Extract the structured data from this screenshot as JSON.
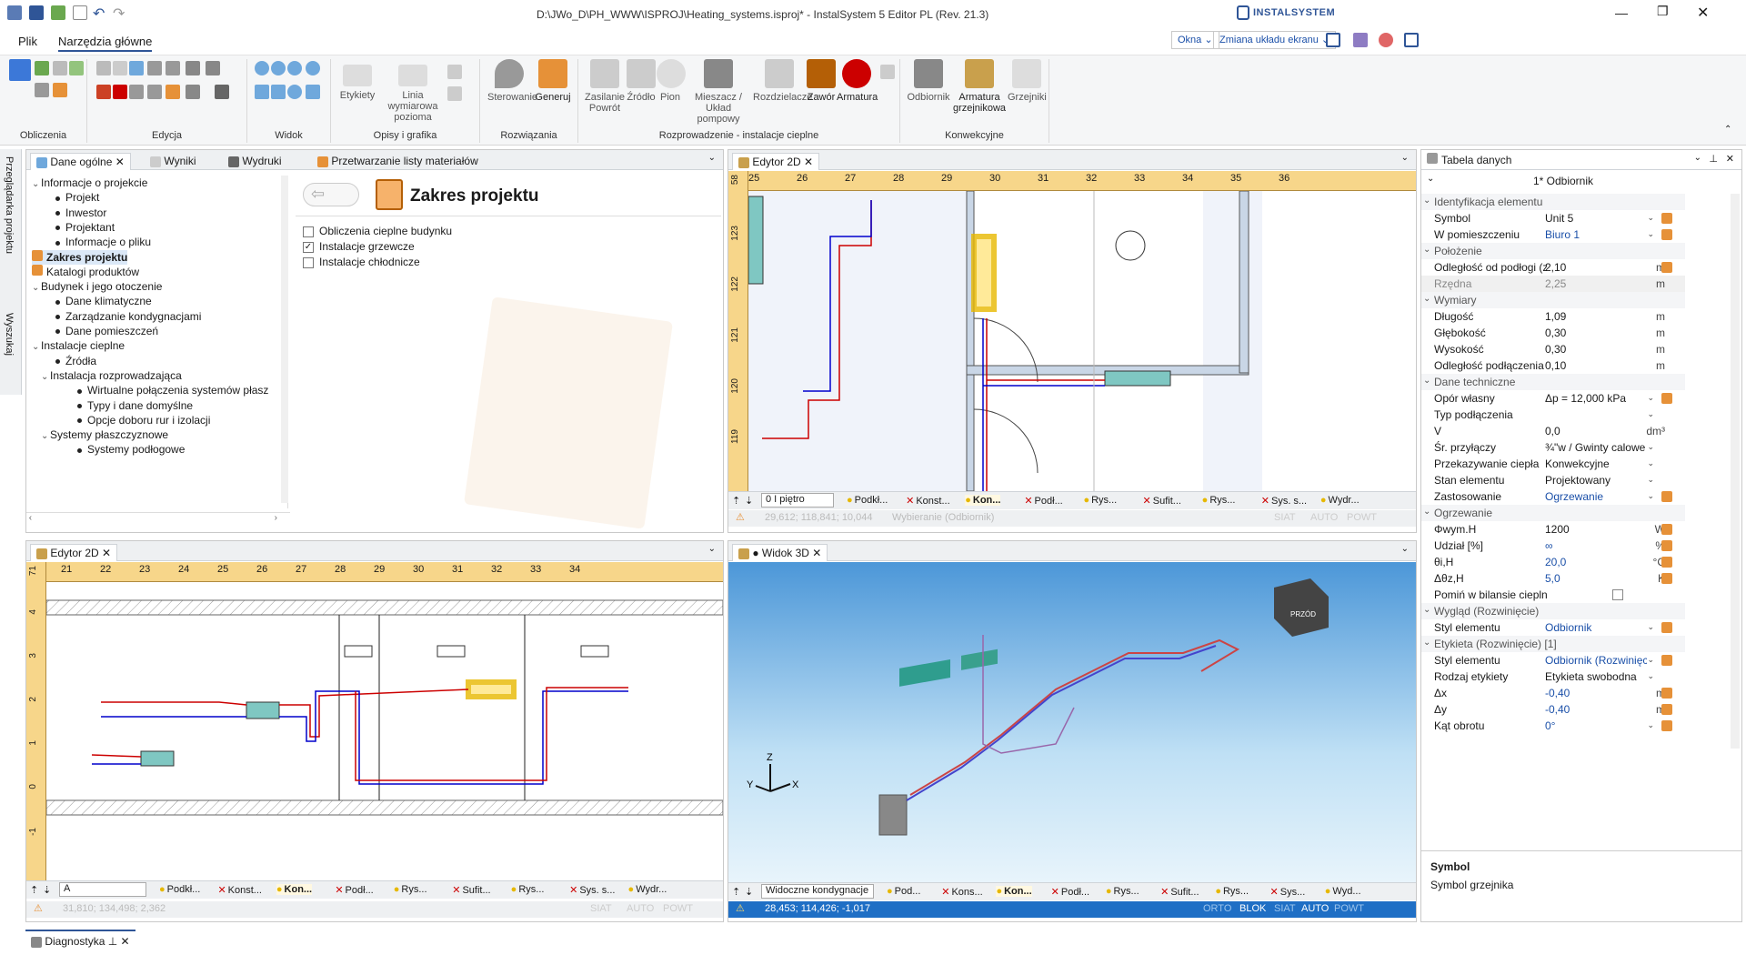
{
  "title": "D:\\JWo_D\\PH_WWW\\ISPROJ\\Heating_systems.isproj* - InstalSystem 5 Editor PL (Rev. 21.3)",
  "brand": "INSTALSYSTEM",
  "menu": {
    "file": "Plik",
    "main_tools": "Narzędzia główne"
  },
  "right_buttons": {
    "window": "Okna",
    "layout": "Zmiana układu ekranu"
  },
  "ribbon": {
    "groups": {
      "calc": "Obliczenia",
      "edit": "Edycja",
      "view": "Widok",
      "desc": "Opisy i grafika",
      "solutions": "Rozwiązania",
      "distribution": "Rozprowadzenie - instalacje cieplne",
      "convective": "Konwekcyjne"
    },
    "buttons": {
      "labels": "Etykiety",
      "dim_line": "Linia wymiarowa\npozioma",
      "control": "Sterowanie",
      "generate": "Generuj",
      "supply_return": "Zasilanie\nPowrót",
      "source": "Źródło",
      "riser": "Pion",
      "mixer": "Mieszacz / Układ\npompowy",
      "distributors": "Rozdzielacze",
      "valve": "Zawór",
      "fittings": "Armatura",
      "radiator": "Odbiornik",
      "radiator_fittings": "Armatura\ngrzejnikowa",
      "heaters": "Grzejniki"
    }
  },
  "left_panel": {
    "tabs": [
      "Dane ogólne",
      "Wyniki",
      "Wydruki",
      "Przetwarzanie listy materiałów"
    ],
    "tree": [
      {
        "label": "Informacje o projekcie",
        "lvl": 0,
        "chev": "v"
      },
      {
        "label": "Projekt",
        "lvl": 2
      },
      {
        "label": "Inwestor",
        "lvl": 2
      },
      {
        "label": "Projektant",
        "lvl": 2
      },
      {
        "label": "Informacje o pliku",
        "lvl": 2
      },
      {
        "label": "Zakres projektu",
        "lvl": 0,
        "sel": true
      },
      {
        "label": "Katalogi produktów",
        "lvl": 0
      },
      {
        "label": "Budynek i jego otoczenie",
        "lvl": 0,
        "chev": "v"
      },
      {
        "label": "Dane klimatyczne",
        "lvl": 2
      },
      {
        "label": "Zarządzanie kondygnacjami",
        "lvl": 2
      },
      {
        "label": "Dane pomieszczeń",
        "lvl": 2
      },
      {
        "label": "Instalacje cieplne",
        "lvl": 0,
        "chev": "v"
      },
      {
        "label": "Źródła",
        "lvl": 2
      },
      {
        "label": "Instalacja rozprowadzająca",
        "lvl": 1,
        "chev": "v"
      },
      {
        "label": "Wirtualne połączenia systemów płasz",
        "lvl": 3
      },
      {
        "label": "Typy i dane domyślne",
        "lvl": 3
      },
      {
        "label": "Opcje doboru rur i izolacji",
        "lvl": 3
      },
      {
        "label": "Systemy płaszczyznowe",
        "lvl": 1,
        "chev": "v"
      },
      {
        "label": "Systemy podłogowe",
        "lvl": 3
      }
    ],
    "scope_title": "Zakres projektu",
    "checks": [
      {
        "label": "Obliczenia cieplne budynku",
        "checked": false
      },
      {
        "label": "Instalacje grzewcze",
        "checked": true
      },
      {
        "label": "Instalacje chłodnicze",
        "checked": false
      }
    ]
  },
  "editor_top": {
    "tab": "Edytor 2D",
    "ruler": [
      "25",
      "26",
      "27",
      "28",
      "29",
      "30",
      "31",
      "32",
      "33",
      "34",
      "35",
      "36"
    ],
    "vruler": [
      "58",
      "123",
      "122",
      "121",
      "120",
      "119"
    ],
    "floor": "0 I piętro",
    "layers": [
      "Podkł...",
      "Konst...",
      "Kon...",
      "Podł...",
      "Rys...",
      "Sufit...",
      "Rys...",
      "Sys. s...",
      "Wydr..."
    ],
    "status": "29,612; 118,841; 10,044",
    "status2": "Wybieranie (Odbiornik)",
    "flags": [
      "SIAT",
      "AUTO",
      "POWT"
    ]
  },
  "editor_bottom": {
    "tab": "Edytor 2D",
    "ruler": [
      "21",
      "22",
      "23",
      "24",
      "25",
      "26",
      "27",
      "28",
      "29",
      "30",
      "31",
      "32",
      "33",
      "34"
    ],
    "vruler": [
      "71",
      "4",
      "3",
      "2",
      "1",
      "0",
      "-1"
    ],
    "view": "A",
    "layers": [
      "Podkł...",
      "Konst...",
      "Kon...",
      "Podł...",
      "Rys...",
      "Sufit...",
      "Rys...",
      "Sys. s...",
      "Wydr..."
    ],
    "status": "31,810; 134,498; 2,362",
    "flags": [
      "SIAT",
      "AUTO",
      "POWT"
    ]
  },
  "view3d": {
    "tab": "● Widok 3D",
    "dropdown": "Widoczne kondygnacje",
    "layers": [
      "Pod...",
      "Kons...",
      "Kon...",
      "Podł...",
      "Rys...",
      "Sufit...",
      "Rys...",
      "Sys...",
      "Wyd..."
    ],
    "coords": "28,453; 114,426; -1,017",
    "flags": [
      "ORTO",
      "BLOK",
      "SIAT",
      "AUTO",
      "POWT"
    ],
    "cube_front": "PRZÓD"
  },
  "datatable": {
    "title": "Tabela danych",
    "subtitle": "1* Odbiornik",
    "rows": [
      {
        "t": "sec",
        "name": "Identyfikacja elementu"
      },
      {
        "name": "Symbol",
        "val": "Unit 5",
        "dd": true,
        "edit": true
      },
      {
        "name": "W pomieszczeniu",
        "val": "Biuro 1",
        "dd": true,
        "blue": true,
        "edit": true
      },
      {
        "t": "sec",
        "name": "Położenie"
      },
      {
        "name": "Odległość od podłogi (z dan",
        "val": "2,10",
        "unit": "m",
        "edit": true
      },
      {
        "name": "Rzędna",
        "val": "2,25",
        "unit": "m",
        "grey": true
      },
      {
        "t": "sec",
        "name": "Wymiary"
      },
      {
        "name": "Długość",
        "val": "1,09",
        "unit": "m"
      },
      {
        "name": "Głębokość",
        "val": "0,30",
        "unit": "m"
      },
      {
        "name": "Wysokość",
        "val": "0,30",
        "unit": "m"
      },
      {
        "name": "Odległość podłączenia od k",
        "val": "0,10",
        "unit": "m"
      },
      {
        "t": "sec",
        "name": "Dane techniczne"
      },
      {
        "name": "Opór własny",
        "val": "Δp = 12,000 kPa",
        "dd": true,
        "edit": true
      },
      {
        "name": "Typ podłączenia",
        "val": "",
        "dd": true
      },
      {
        "name": "V",
        "val": "0,0",
        "unit": "dm³"
      },
      {
        "name": "Śr. przyłączy",
        "val": "¾\"w / Gwinty calowe (w)",
        "dd": true
      },
      {
        "name": "Przekazywanie ciepła",
        "val": "Konwekcyjne",
        "dd": true
      },
      {
        "name": "Stan elementu",
        "val": "Projektowany",
        "dd": true
      },
      {
        "name": "Zastosowanie",
        "val": "Ogrzewanie",
        "dd": true,
        "blue": true,
        "edit": true
      },
      {
        "t": "sec",
        "name": "Ogrzewanie"
      },
      {
        "name": "Φwym.H",
        "val": "1200",
        "unit": "W",
        "edit": true
      },
      {
        "name": "Udział [%]",
        "val": "∞",
        "unit": "%",
        "blue": true,
        "edit": true
      },
      {
        "name": "θi,H",
        "val": "20,0",
        "unit": "°C",
        "blue": true,
        "edit": true
      },
      {
        "name": "Δθz,H",
        "val": "5,0",
        "unit": "K",
        "blue": true,
        "edit": true
      },
      {
        "name": "Pomiń w bilansie cieplnym",
        "val": "",
        "check": true
      },
      {
        "t": "sec",
        "name": "Wygląd (Rozwinięcie)"
      },
      {
        "name": "Styl elementu",
        "val": "Odbiornik",
        "dd": true,
        "blue": true,
        "edit": true
      },
      {
        "t": "sec",
        "name": "Etykieta (Rozwinięcie) [1]"
      },
      {
        "name": "Styl elementu",
        "val": "Odbiornik (Rozwinięcie)",
        "dd": true,
        "blue": true,
        "edit": true
      },
      {
        "name": "Rodzaj etykiety",
        "val": "Etykieta swobodna",
        "dd": true
      },
      {
        "name": "Δx",
        "val": "-0,40",
        "unit": "m",
        "blue": true,
        "edit": true
      },
      {
        "name": "Δy",
        "val": "-0,40",
        "unit": "m",
        "blue": true,
        "edit": true
      },
      {
        "name": "Kąt obrotu",
        "val": "0°",
        "dd": true,
        "blue": true,
        "edit": true
      }
    ],
    "help_title": "Symbol",
    "help_text": "Symbol grzejnika"
  },
  "side_tabs": [
    "Przeglądarka projektu",
    "Wyszukaj"
  ],
  "diagnostics": "Diagnostyka"
}
